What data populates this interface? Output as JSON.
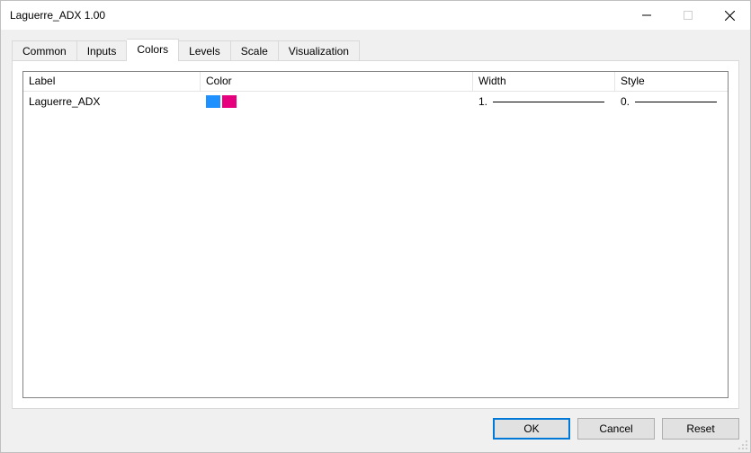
{
  "window": {
    "title": "Laguerre_ADX 1.00"
  },
  "tabs": [
    {
      "label": "Common",
      "active": false
    },
    {
      "label": "Inputs",
      "active": false
    },
    {
      "label": "Colors",
      "active": true
    },
    {
      "label": "Levels",
      "active": false
    },
    {
      "label": "Scale",
      "active": false
    },
    {
      "label": "Visualization",
      "active": false
    }
  ],
  "colors_table": {
    "headers": {
      "label": "Label",
      "color": "Color",
      "width": "Width",
      "style": "Style"
    },
    "rows": [
      {
        "label": "Laguerre_ADX",
        "colors": [
          "#1e90ff",
          "#e6007e"
        ],
        "width_index": "1.",
        "style_index": "0."
      }
    ]
  },
  "buttons": {
    "ok": "OK",
    "cancel": "Cancel",
    "reset": "Reset"
  }
}
